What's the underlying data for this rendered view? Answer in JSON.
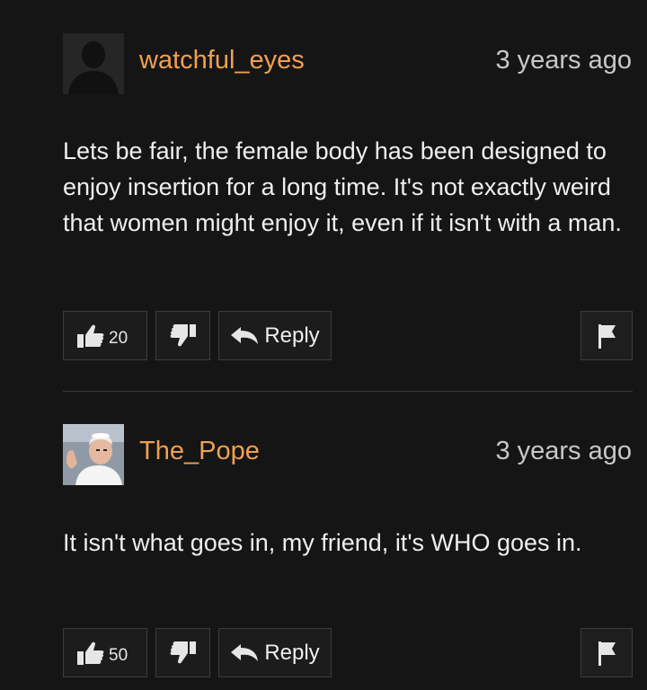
{
  "comments": [
    {
      "username": "watchful_eyes",
      "timestamp": "3 years ago",
      "avatar": "default-silhouette-icon",
      "text": "Lets be fair, the female body has been designed to enjoy insertion for a long time. It's not exactly weird that women might enjoy it, even if it isn't with a man.",
      "likes": "20",
      "reply_label": "Reply"
    },
    {
      "username": "The_Pope",
      "timestamp": "3 years ago",
      "avatar": "pope-photo",
      "text": "It isn't what goes in, my friend, it's WHO goes in.",
      "likes": "50",
      "reply_label": "Reply"
    }
  ],
  "colors": {
    "background": "#151515",
    "username": "#f0a050",
    "text": "#efefef",
    "button_border": "#3c3c3c"
  }
}
